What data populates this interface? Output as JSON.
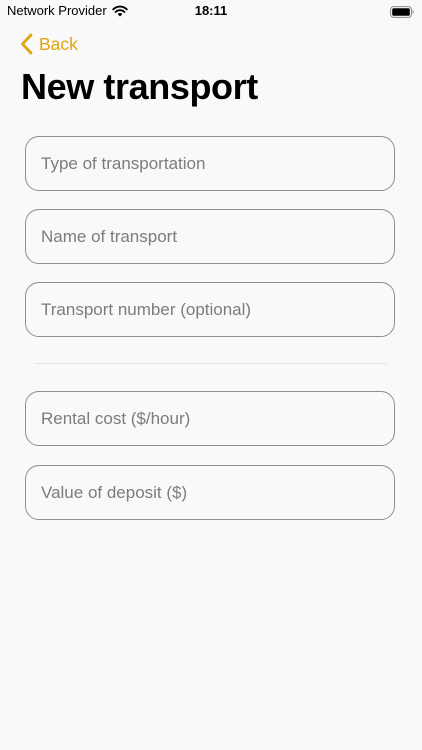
{
  "status_bar": {
    "carrier": "Network Provider",
    "time": "18:11",
    "wifi_icon": "wifi-icon",
    "battery_icon": "battery-full-icon"
  },
  "nav": {
    "back_label": "Back",
    "back_icon": "chevron-left-icon",
    "accent_color": "#e0a510"
  },
  "page": {
    "title": "New transport"
  },
  "form": {
    "transport_type": {
      "placeholder": "Type of transportation",
      "value": ""
    },
    "transport_name": {
      "placeholder": "Name of transport",
      "value": ""
    },
    "transport_number": {
      "placeholder": "Transport number (optional)",
      "value": ""
    },
    "rental_cost": {
      "placeholder": "Rental cost ($/hour)",
      "value": ""
    },
    "deposit_value": {
      "placeholder": "Value of deposit ($)",
      "value": ""
    }
  }
}
